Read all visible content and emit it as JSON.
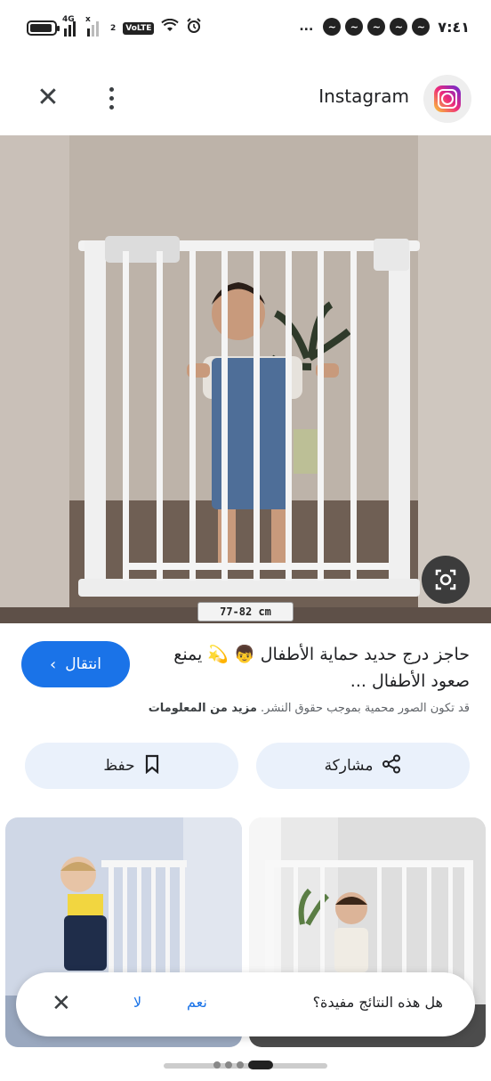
{
  "status_bar": {
    "signal_1_tag": "4G",
    "signal_2_tag": "x",
    "sim2": "2",
    "volte": "VoLTE",
    "dots": "...",
    "time": "٧:٤١"
  },
  "header": {
    "site_name": "Instagram"
  },
  "main_image": {
    "size_label": "77-82 cm"
  },
  "result": {
    "title": "حاجز درج حديد حماية الأطفال 👦 💫 يمنع صعود الأطفال ...",
    "visit_label": "انتقال",
    "copyright_text": "قد تكون الصور محمية بموجب حقوق النشر.",
    "more_info": "مزيد من المعلومات",
    "share_label": "مشاركة",
    "save_label": "حفظ"
  },
  "feedback": {
    "question": "هل هذه النتائج مفيدة؟",
    "yes": "نعم",
    "no": "لا"
  }
}
